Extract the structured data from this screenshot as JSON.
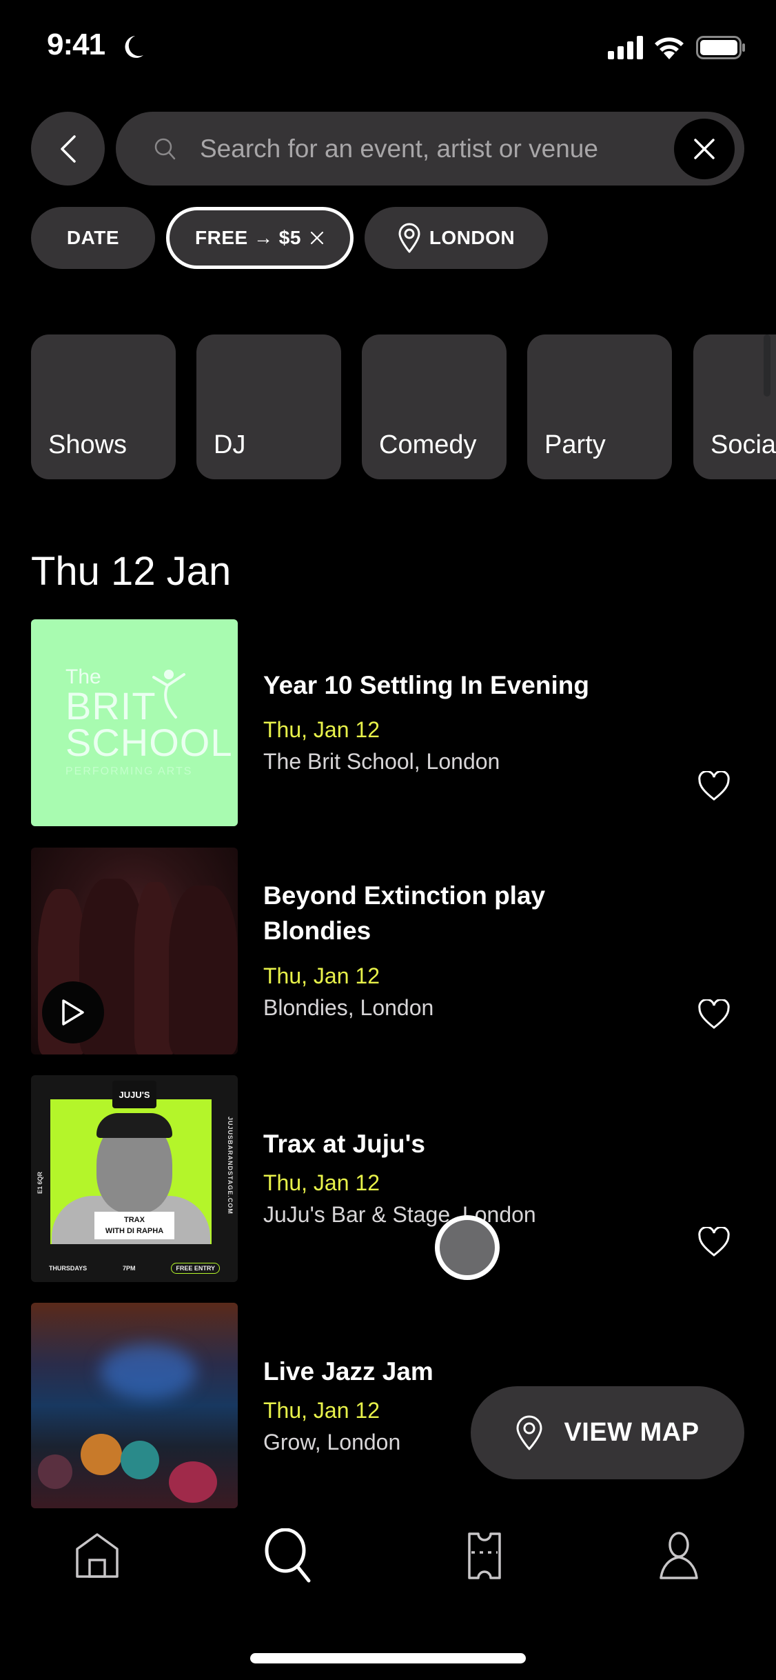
{
  "status_bar": {
    "time": "9:41",
    "focus_icon": "moon-icon",
    "signal_icon": "cellular-signal-icon",
    "wifi_icon": "wifi-icon",
    "battery_icon": "battery-icon"
  },
  "search": {
    "back_icon": "chevron-left-icon",
    "search_icon": "search-icon",
    "placeholder": "Search for an event, artist or venue",
    "value": "",
    "clear_icon": "close-icon"
  },
  "filters": [
    {
      "label": "DATE",
      "active": false
    },
    {
      "label": "FREE → $5",
      "active": true,
      "remove_icon": "close-icon"
    },
    {
      "label": "LONDON",
      "icon": "location-pin-icon",
      "active": false
    }
  ],
  "categories": [
    {
      "label": "Shows"
    },
    {
      "label": "DJ"
    },
    {
      "label": "Comedy"
    },
    {
      "label": "Party"
    },
    {
      "label": "Social"
    }
  ],
  "section": {
    "title": "Thu 12 Jan"
  },
  "events": [
    {
      "title": "Year 10 Settling In Evening",
      "date": "Thu, Jan 12",
      "venue": "The Brit School, London",
      "thumbnail": {
        "the": "The",
        "line1": "BRIT",
        "line2": "SCHOOL",
        "subline": "PERFORMING ARTS"
      },
      "favorite": false
    },
    {
      "title": "Beyond Extinction play Blondies",
      "date": "Thu, Jan 12",
      "venue": "Blondies, London",
      "has_preview": true,
      "favorite": false
    },
    {
      "title": "Trax at Juju's",
      "date": "Thu, Jan 12",
      "venue": "JuJu's Bar & Stage, London",
      "thumbnail": {
        "badge": "JUJU'S",
        "caption_line1": "TRAX",
        "caption_line2": "WITH DI RAPHA",
        "footer": [
          "THURSDAYS",
          "7PM",
          "FREE ENTRY"
        ],
        "side_right": "JUJUSBARANDSTAGE.COM",
        "side_left": "E1 6QR"
      },
      "favorite": false
    },
    {
      "title": "Live Jazz Jam",
      "date": "Thu, Jan 12",
      "venue": "Grow, London",
      "favorite": false
    }
  ],
  "view_map": {
    "label": "VIEW MAP",
    "icon": "location-pin-icon"
  },
  "tabbar": [
    {
      "name": "home",
      "icon": "home-icon",
      "active": false
    },
    {
      "name": "search",
      "icon": "search-icon",
      "active": true
    },
    {
      "name": "tickets",
      "icon": "ticket-icon",
      "active": false
    },
    {
      "name": "profile",
      "icon": "profile-icon",
      "active": false
    }
  ],
  "colors": {
    "background": "#000000",
    "surface": "#363436",
    "accent_date": "#e8f24a",
    "venue_text": "#d8d6d8",
    "placeholder_text": "#a8a6a8"
  }
}
